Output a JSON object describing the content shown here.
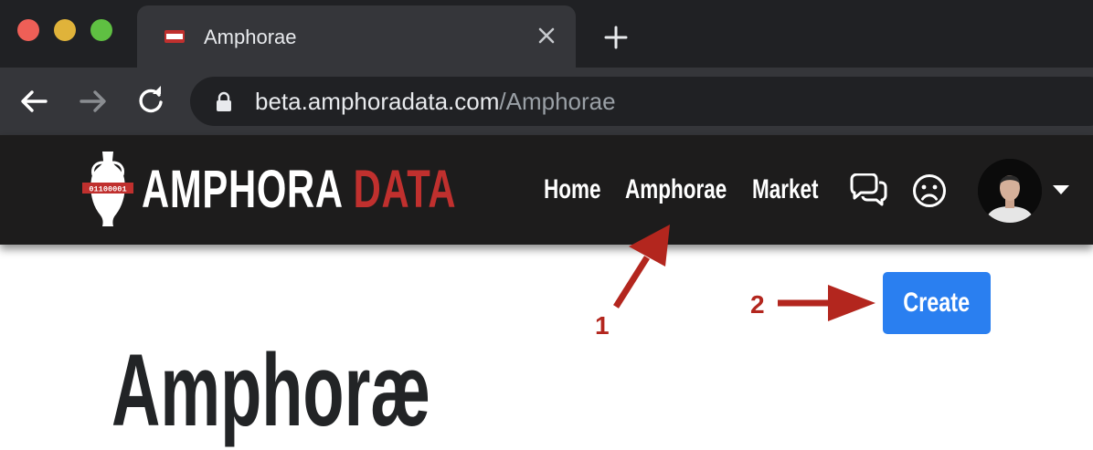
{
  "browser": {
    "tab": {
      "title": "Amphorae",
      "favicon_text": "01100001"
    },
    "url": {
      "host": "beta.amphoradata.com",
      "path": "/Amphorae"
    },
    "icons": [
      "back-icon",
      "forward-icon",
      "reload-icon",
      "lock-icon",
      "close-icon",
      "plus-icon"
    ]
  },
  "site": {
    "brand": {
      "part1": "AMPHORA",
      "part2": "DATA",
      "logo_binary": "01100001"
    },
    "nav": {
      "home": "Home",
      "amphorae": "Amphorae",
      "market": "Market"
    },
    "icons": [
      "amphora-logo-icon",
      "chat-icon",
      "frown-icon",
      "avatar",
      "caret-down-icon"
    ]
  },
  "page": {
    "title": "Amphoræ",
    "create_label": "Create"
  },
  "annotations": {
    "step1": "1",
    "step2": "2",
    "color": "#b3261e"
  },
  "colors": {
    "brand_red": "#c0302e",
    "create_blue": "#2a7ff0",
    "nav_bg": "#1d1c1c"
  }
}
